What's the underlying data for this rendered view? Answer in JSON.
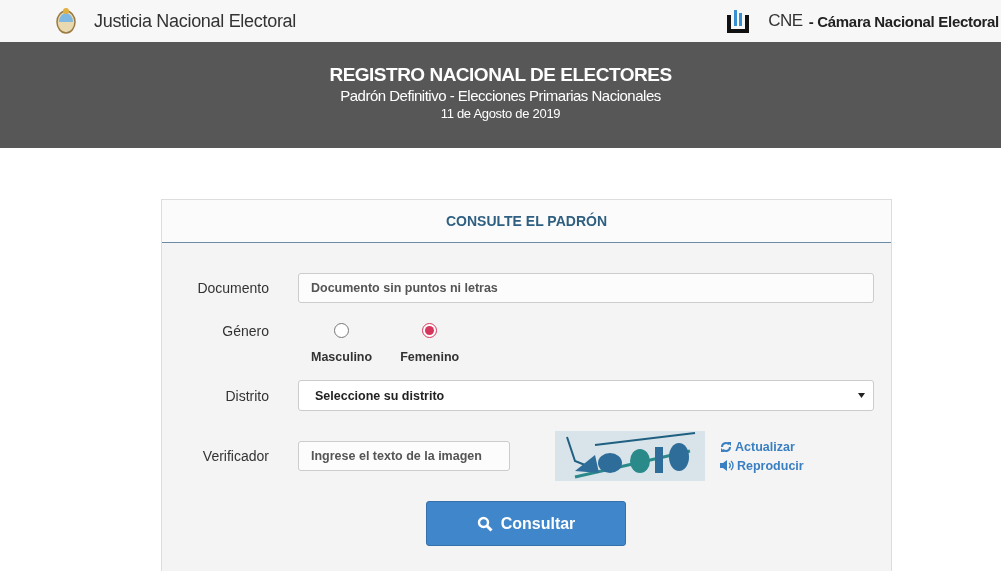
{
  "top_bar": {
    "left_title": "Justicia Nacional Electoral",
    "right_abbr": "CNE",
    "right_title": "- Cámara Nacional Electoral"
  },
  "banner": {
    "title": "REGISTRO NACIONAL DE ELECTORES",
    "subtitle": "Padrón Definitivo - Elecciones Primarias Nacionales",
    "date": "11 de Agosto de 2019"
  },
  "form": {
    "heading": "CONSULTE EL PADRÓN",
    "documento": {
      "label": "Documento",
      "placeholder": "Documento sin puntos ni letras"
    },
    "genero": {
      "label": "Género",
      "options": [
        {
          "label": "Masculino",
          "selected": false
        },
        {
          "label": "Femenino",
          "selected": true
        }
      ]
    },
    "distrito": {
      "label": "Distrito",
      "value": "Seleccione su distrito"
    },
    "verificador": {
      "label": "Verificador",
      "placeholder": "Ingrese el texto de la imagen",
      "refresh": "Actualizar",
      "play": "Reproducir"
    },
    "submit": "Consultar"
  }
}
